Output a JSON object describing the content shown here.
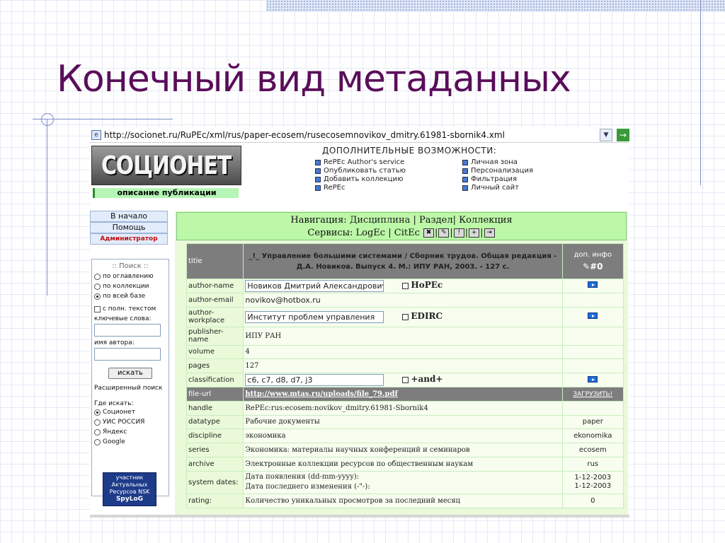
{
  "slide": {
    "title": "Конечный вид метаданных"
  },
  "browser": {
    "url": "http://socionet.ru/RuPEc/xml/rus/paper-ecosem/rusecosemnovikov_dmitry.61981-sbornik4.xml"
  },
  "header": {
    "logo_text": "СОЦИОНЕТ",
    "pub_desc": "описание публикации",
    "extra_title": "ДОПОЛНИТЕЛЬНЫЕ ВОЗМОЖНОСТИ:",
    "left_links": [
      "RePEc Author's service",
      "Опубликовать статью",
      "Добавить коллекцию",
      "RePEc"
    ],
    "right_links": [
      "Личная зона",
      "Персонализация",
      "Фильтрация",
      "Личный сайт"
    ]
  },
  "left": {
    "home": "В начало",
    "help": "Помощь",
    "admin": "Администратор",
    "search_title": ":: Поиск ::",
    "scope": [
      "по оглавлению",
      "по коллекции",
      "по всей базе"
    ],
    "fulltext": "с полн. текстом",
    "keywords_label": "ключевые слова:",
    "author_label": "имя автора:",
    "search_btn": "искать",
    "advanced": "Расширенный поиск",
    "where": "Где искать:",
    "engines": [
      "Соционет",
      "УИС РОССИЯ",
      "Яндекс",
      "Google"
    ],
    "badge": [
      "участник",
      "Актуальных",
      "Ресурсов",
      "NSK",
      "SpyLoG"
    ]
  },
  "nav": {
    "nav_label": "Навигация:",
    "discipline": "Дисциплина",
    "sep": "|",
    "section": "Раздел",
    "collection": "Коллекция",
    "services_label": "Сервисы:",
    "logec": "LogEc",
    "citec": "CitEc"
  },
  "record": {
    "title_key": "title",
    "title": "_!_ Управление большими системами / Сборник трудов. Общая редакция - Д.А. Новиков. Выпуск 4. М.: ИПУ РАН, 2003. - 127 с.",
    "extra_head": "доп. инфо",
    "extra_count": "#0",
    "author_name_k": "author-name",
    "author_name": "Новиков Дмитрий Александрович",
    "hopec": "HoPEc",
    "author_email_k": "author-email",
    "author_email": "novikov@hotbox.ru",
    "author_workplace_k": "author-workplace",
    "author_workplace": "Институт проблем управления",
    "edirc": "EDIRC",
    "publisher_k": "publisher-name",
    "publisher": "ИПУ РАН",
    "volume_k": "volume",
    "volume": "4",
    "pages_k": "pages",
    "pages": "127",
    "class_k": "classification",
    "classification": "c6, c7, d8, d7, j3",
    "and": "+and+",
    "fileurl_k": "file-url",
    "fileurl": "http://www.mtas.ru/uploads/file_79.pdf",
    "download": "ЗАГРУЗИТЬ!",
    "handle_k": "handle",
    "handle": "RePEc:rus:ecosem:novikov_dmitry.61981-Sbornik4",
    "datatype_k": "datatype",
    "datatype": "Рабочие документы",
    "datatype_x": "paper",
    "discipline_k": "discipline",
    "discipline": "экономика",
    "discipline_x": "ekonomika",
    "series_k": "series",
    "series": "Экономика: материалы научных конференций и семинаров",
    "series_x": "ecosem",
    "archive_k": "archive",
    "archive": "Электронные коллекции ресурсов по общественным наукам",
    "archive_x": "rus",
    "dates_k": "system dates:",
    "date1": "Дата появления (dd-mm-yyyy):",
    "date2": "Дата последнего изменения (-\"-):",
    "date1_x": "1-12-2003",
    "date2_x": "1-12-2003",
    "rating_k": "rating:",
    "rating": "Количество уникальных просмотров за последний месяц",
    "rating_x": "0"
  }
}
